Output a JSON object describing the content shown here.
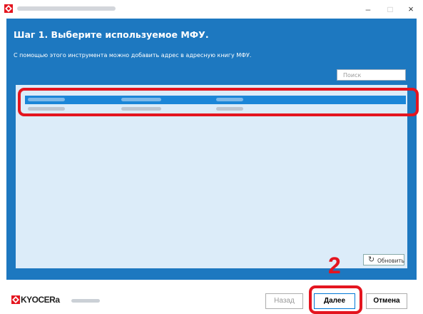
{
  "window": {
    "min_symbol": "–",
    "max_symbol": "□",
    "close_symbol": "×"
  },
  "wizard": {
    "heading": "Шаг 1. Выберите используемое МФУ.",
    "description": "С помощью этого инструмента можно добавить адрес в адресную книгу МФУ.",
    "search_placeholder": "Поиск",
    "refresh_label": "Обновить",
    "refresh_icon": "↻",
    "step_callout": "2"
  },
  "footer": {
    "brand": "KYOCERa",
    "back_label": "Назад",
    "next_label": "Далее",
    "cancel_label": "Отмена"
  },
  "colors": {
    "accent_blue": "#1d78c0",
    "selection_blue": "#1b86d8",
    "callout_red": "#e4151f"
  }
}
